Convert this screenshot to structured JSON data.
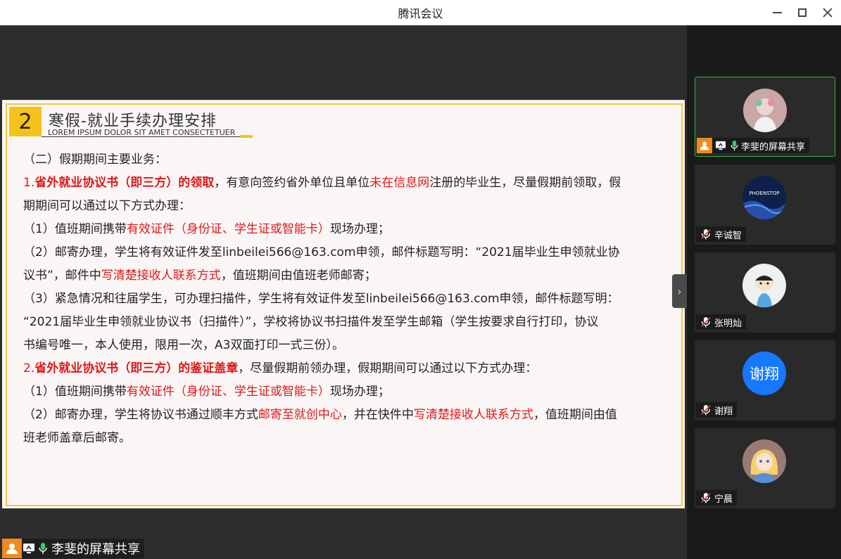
{
  "window": {
    "title": "腾讯会议"
  },
  "slide": {
    "number": "2",
    "title": "寒假-就业手续办理安排",
    "subtitle": "LOREM IPSUM DOLOR SIT AMET CONSECTETUER",
    "lines": [
      {
        "parts": [
          {
            "t": "（二）假期期间主要业务："
          }
        ]
      },
      {
        "parts": [
          {
            "t": "1.",
            "c": "red"
          },
          {
            "t": "省外就业协议书（即三方）的领取",
            "c": "red bold"
          },
          {
            "t": "，有意向签约省外单位且单位"
          },
          {
            "t": "未在信息网",
            "c": "red"
          },
          {
            "t": "注册的毕业生，尽量假期前领取，假"
          }
        ]
      },
      {
        "parts": [
          {
            "t": "期期间可以通过以下方式办理："
          }
        ]
      },
      {
        "parts": [
          {
            "t": "（1）值班期间携带"
          },
          {
            "t": "有效证件（身份证、学生证或智能卡）",
            "c": "red"
          },
          {
            "t": "现场办理；"
          }
        ]
      },
      {
        "parts": [
          {
            "t": "（2）邮寄办理，学生将有效证件发至linbeilei566@163.com申领，邮件标题写明：“2021届毕业生申领就业协"
          }
        ]
      },
      {
        "parts": [
          {
            "t": "议书”，邮件中"
          },
          {
            "t": "写清楚接收人联系方式",
            "c": "red"
          },
          {
            "t": "，值班期间由值班老师邮寄；"
          }
        ]
      },
      {
        "parts": [
          {
            "t": "（3）紧急情况和往届学生，可办理扫描件，学生将有效证件发至linbeilei566@163.com申领，邮件标题写明："
          }
        ]
      },
      {
        "parts": [
          {
            "t": "“2021届毕业生申领就业协议书（扫描件）”，学校将协议书扫描件发至学生邮箱（学生按要求自行打印，协议"
          }
        ]
      },
      {
        "parts": [
          {
            "t": "书编号唯一，本人使用，限用一次，A3双面打印一式三份）。"
          }
        ]
      },
      {
        "parts": [
          {
            "t": " "
          }
        ]
      },
      {
        "parts": [
          {
            "t": "2.",
            "c": "red"
          },
          {
            "t": "省外就业协议书（即三方）的鉴证盖章",
            "c": "red bold"
          },
          {
            "t": "，尽量假期前领办理，假期期间可以通过以下方式办理："
          }
        ]
      },
      {
        "parts": [
          {
            "t": "（1）值班期间携带"
          },
          {
            "t": "有效证件（身份证、学生证或智能卡）",
            "c": "red"
          },
          {
            "t": "现场办理；"
          }
        ]
      },
      {
        "parts": [
          {
            "t": "（2）邮寄办理，学生将协议书通过顺丰方式"
          },
          {
            "t": "邮寄至就创中心",
            "c": "red"
          },
          {
            "t": "，并在快件中"
          },
          {
            "t": "写清楚接收人联系方式",
            "c": "red"
          },
          {
            "t": "，值班期间由值"
          }
        ]
      },
      {
        "parts": [
          {
            "t": "班老师盖章后邮寄。"
          }
        ]
      }
    ]
  },
  "share_bar": {
    "label": "李斐的屏幕共享"
  },
  "participants": [
    {
      "name": "李斐的屏幕共享",
      "active": true,
      "avatar": "girl-avatar"
    },
    {
      "name": "辛诚智",
      "avatar": "phoenstop-logo",
      "avatar_text": "PHOENSTOP"
    },
    {
      "name": "张明灿",
      "avatar": "cartoon-boy-avatar"
    },
    {
      "name": "谢翔",
      "avatar": "initials-avatar",
      "avatar_text": "谢翔"
    },
    {
      "name": "宁晨",
      "avatar": "alice-avatar"
    }
  ],
  "colors": {
    "accent": "#f6c21a",
    "highlight_red": "#e01818",
    "active_border": "#2fb34c",
    "mic_green": "#2fd35a"
  }
}
